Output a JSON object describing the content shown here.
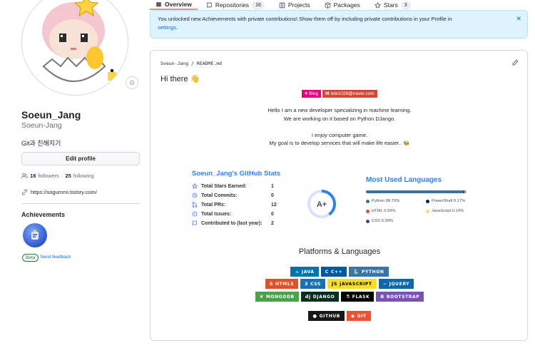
{
  "nav": {
    "tabs": [
      {
        "label": "Overview",
        "count": ""
      },
      {
        "label": "Repositories",
        "count": "16"
      },
      {
        "label": "Projects",
        "count": ""
      },
      {
        "label": "Packages",
        "count": ""
      },
      {
        "label": "Stars",
        "count": "3"
      }
    ]
  },
  "flash": {
    "message": "You unlocked new Achievements with private contributions! Show them off by including private contributions in your Profile in",
    "link": "settings",
    "period": ".",
    "close": "✕"
  },
  "profile": {
    "name": "Soeun_Jang",
    "login": "Soeun-Jang",
    "bio": "Git과 친해지기",
    "edit_button": "Edit profile",
    "followers_count": "18",
    "followers_label": "followers",
    "dot": "·",
    "following_count": "25",
    "following_label": "following",
    "website": "https://sogummi.tistory.com/",
    "achievements_title": "Achievements",
    "beta_label": "Beta",
    "feedback_label": "Send feedback"
  },
  "readme": {
    "path": "Soeun-Jang / README.md",
    "greeting": "Hi there 👋",
    "pills": [
      {
        "label": "Blog",
        "color": "#e4007f",
        "icon": "♥"
      },
      {
        "label": "lele1028@naver.com",
        "color": "#d14836",
        "icon": "M"
      }
    ],
    "intro": [
      "Hello I am a new developer specializing in machine learning.",
      "We are working on it based on Python DJango.",
      "",
      "I enjoy computer game.",
      "My goal is to develop services that will make life easier.. 🐝"
    ],
    "stats": {
      "title": "Soeun_Jang's GitHub Stats",
      "rows": [
        {
          "label": "Total Stars Earned:",
          "value": "1",
          "icon": "star-icon"
        },
        {
          "label": "Total Commits:",
          "value": "0",
          "icon": "clock-icon"
        },
        {
          "label": "Total PRs:",
          "value": "12",
          "icon": "pull-request-icon"
        },
        {
          "label": "Total Issues:",
          "value": "0",
          "icon": "issue-icon"
        },
        {
          "label": "Contributed to (last year):",
          "value": "2",
          "icon": "repo-icon"
        }
      ],
      "grade": "A+",
      "grade_progress": 0.4
    },
    "languages": {
      "title": "Most Used Languages",
      "items": [
        {
          "name": "Python 98.70%",
          "percent": 98.7,
          "color": "#3572A5"
        },
        {
          "name": "PowerShell 0.17%",
          "percent": 0.17,
          "color": "#012456"
        },
        {
          "name": "HTML 0.59%",
          "percent": 0.59,
          "color": "#e34c26"
        },
        {
          "name": "JavaScript 0.14%",
          "percent": 0.14,
          "color": "#f1e05a"
        },
        {
          "name": "CSS 0.39%",
          "percent": 0.39,
          "color": "#563d7c"
        }
      ]
    },
    "platforms_title": "Platforms & Languages",
    "badge_rows": [
      [
        {
          "label": "JAVA",
          "color": "#0074a8",
          "icon": "☕"
        },
        {
          "label": "C++",
          "color": "#00599c",
          "icon": "C"
        },
        {
          "label": "PYTHON",
          "color": "#3776ab",
          "icon": "🐍"
        }
      ],
      [
        {
          "label": "HTML5",
          "color": "#e34f26",
          "icon": "5"
        },
        {
          "label": "CSS",
          "color": "#1572b6",
          "icon": "3"
        },
        {
          "label": "JAVASCRIPT",
          "color": "#f7df1e",
          "icon": "JS",
          "text_color": "#000000"
        },
        {
          "label": "JQUERY",
          "color": "#0769ad",
          "icon": "~"
        }
      ],
      [
        {
          "label": "MONGODB",
          "color": "#47a248",
          "icon": "❦"
        },
        {
          "label": "DJANGO",
          "color": "#092e20",
          "icon": "dj"
        },
        {
          "label": "FLASK",
          "color": "#000000",
          "icon": "⚗"
        },
        {
          "label": "BOOTSTRAP",
          "color": "#7952b3",
          "icon": "B"
        }
      ],
      [
        {
          "label": "GITHUB",
          "color": "#181717",
          "icon": "●"
        },
        {
          "label": "GIT",
          "color": "#f05032",
          "icon": "◆"
        }
      ]
    ]
  }
}
